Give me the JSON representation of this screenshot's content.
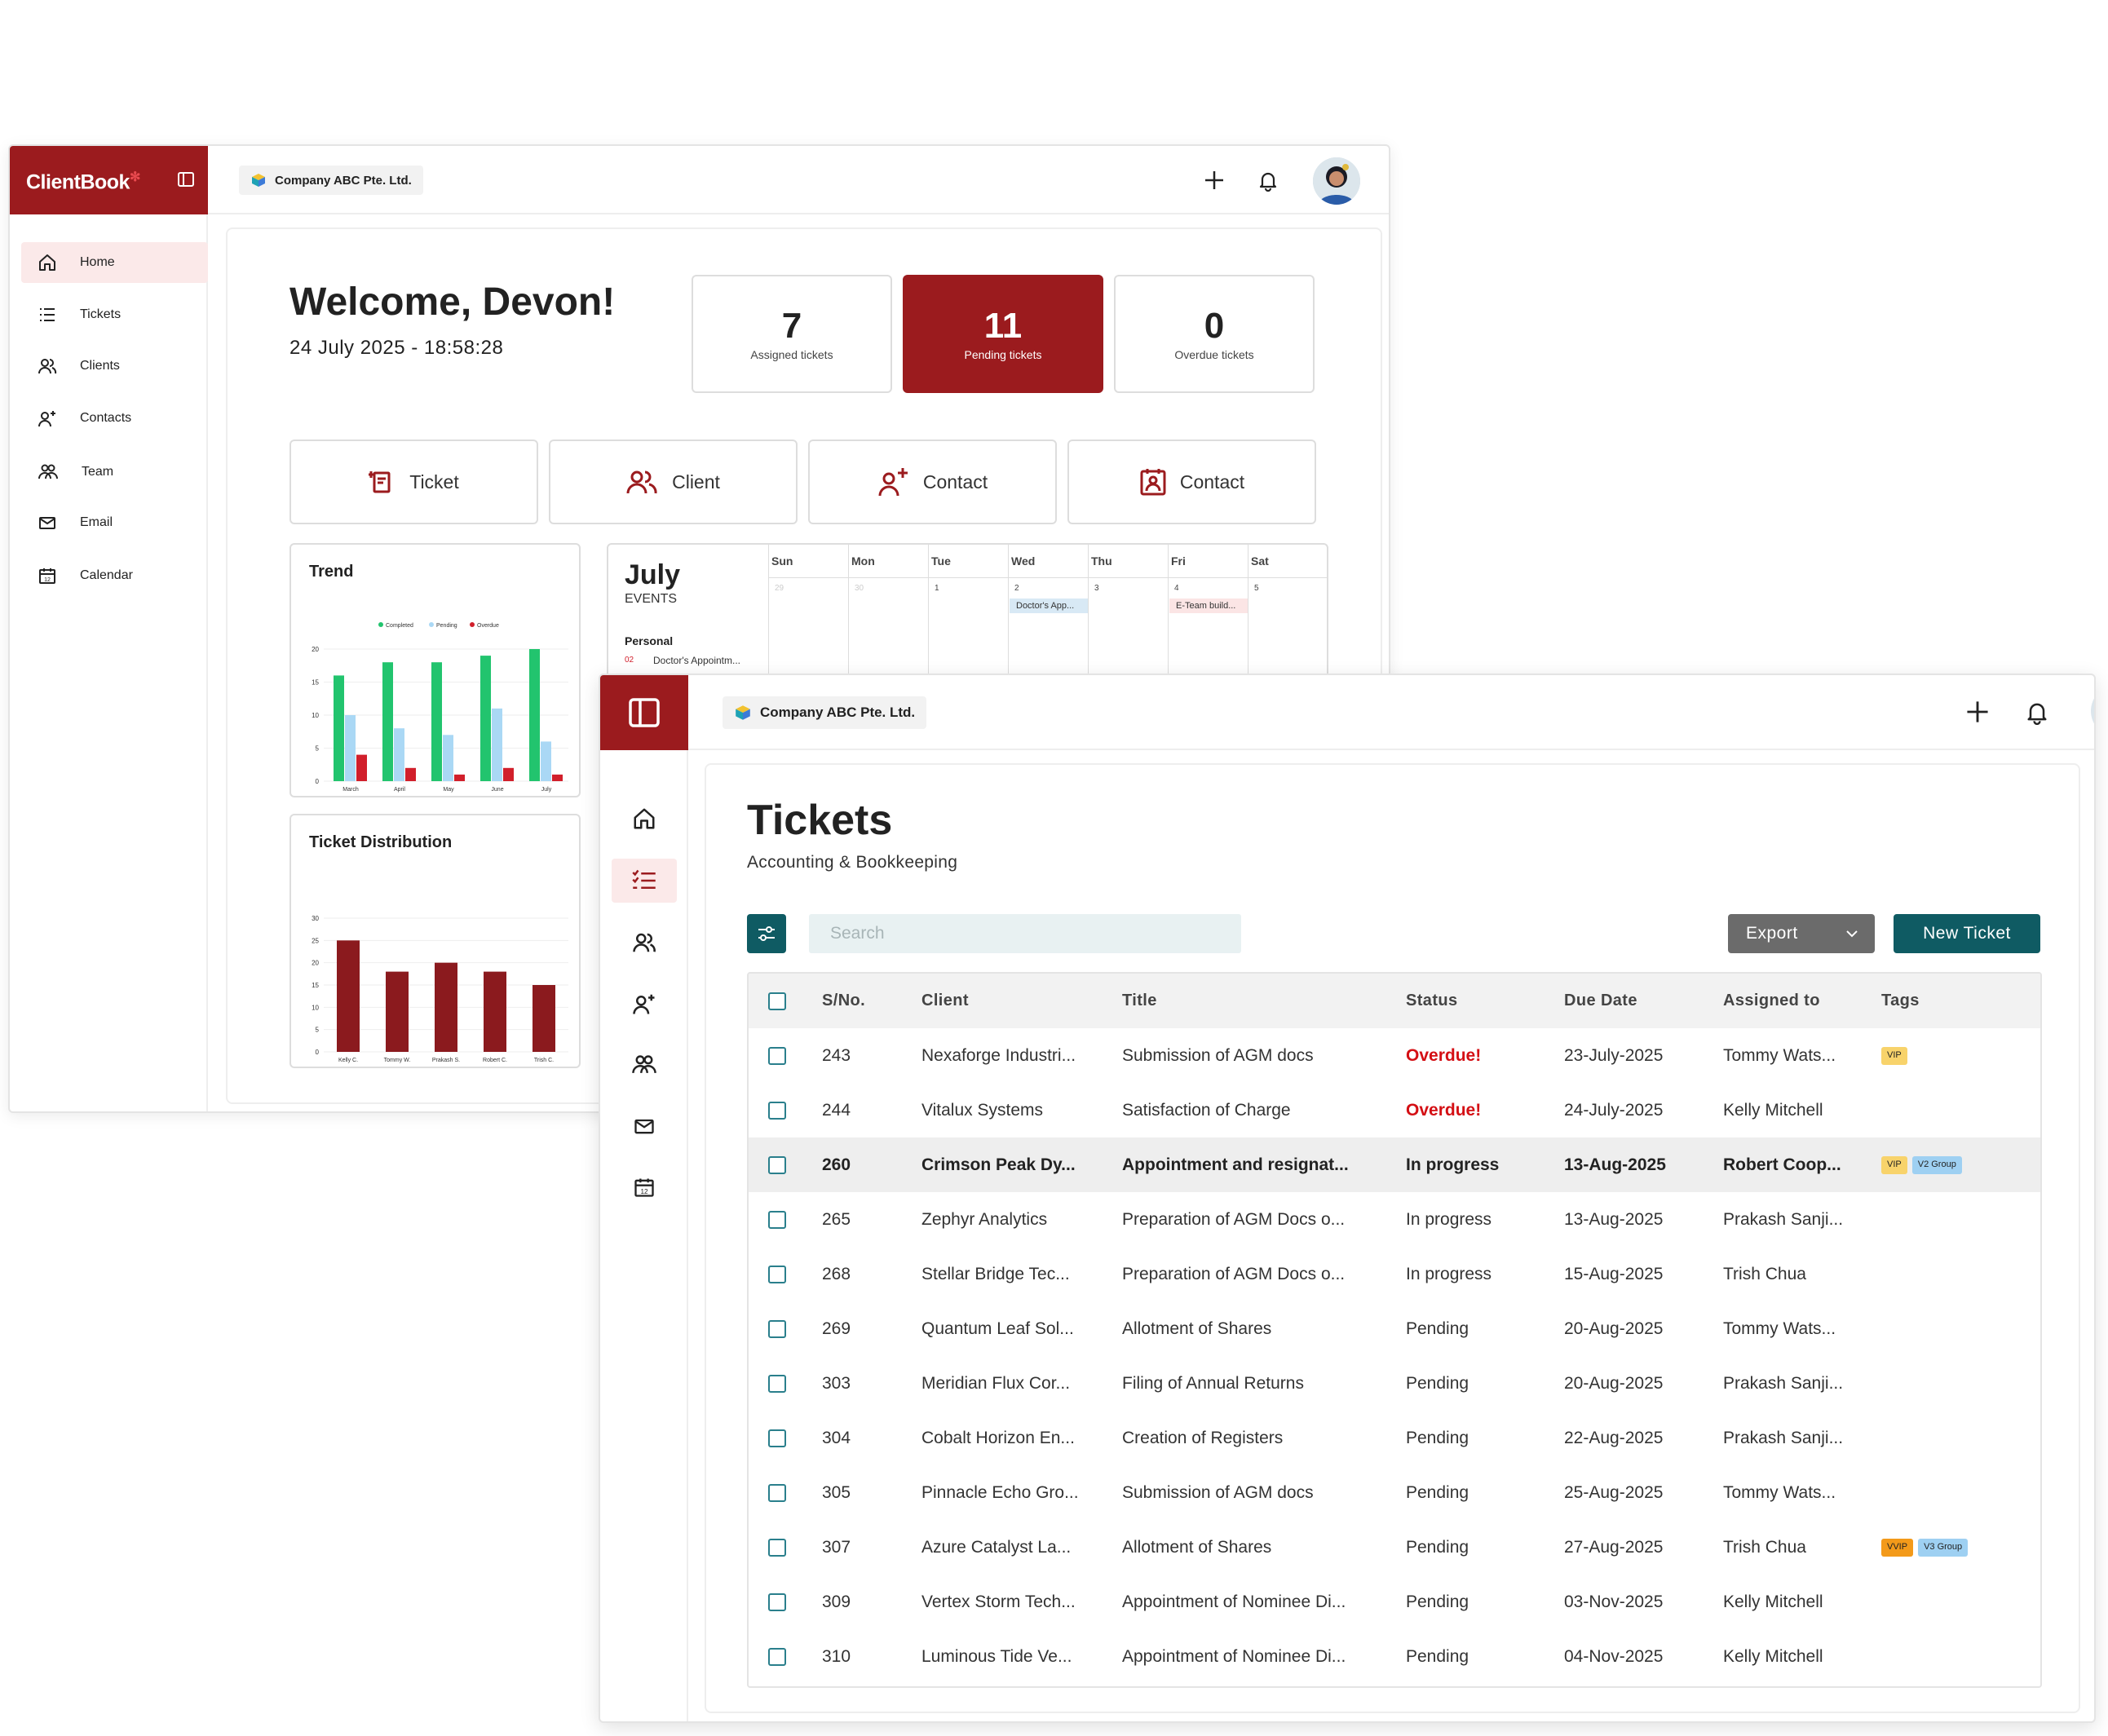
{
  "colors": {
    "brand": "#9b1b1e",
    "teal": "#0f5b63",
    "overdue": "#d40f14",
    "completed": "#22c46e",
    "pending": "#aad8f5",
    "overdue_bar": "#d11f2b",
    "distribution": "#8b1a1e"
  },
  "dashboard": {
    "brand_name": "ClientBook",
    "company": "Company ABC Pte. Ltd.",
    "nav": [
      {
        "label": "Home",
        "icon": "home-icon",
        "active": true
      },
      {
        "label": "Tickets",
        "icon": "list-icon"
      },
      {
        "label": "Clients",
        "icon": "users-icon"
      },
      {
        "label": "Contacts",
        "icon": "user-plus-icon"
      },
      {
        "label": "Team",
        "icon": "team-icon"
      },
      {
        "label": "Email",
        "icon": "mail-icon"
      },
      {
        "label": "Calendar",
        "icon": "calendar-icon"
      }
    ],
    "welcome": "Welcome, Devon!",
    "datetime": "24 July 2025 - 18:58:28",
    "stats": [
      {
        "value": "7",
        "label": "Assigned tickets"
      },
      {
        "value": "11",
        "label": "Pending tickets"
      },
      {
        "value": "0",
        "label": "Overdue tickets"
      }
    ],
    "quick_actions": [
      {
        "label": "Ticket",
        "icon": "ticket-add-icon"
      },
      {
        "label": "Client",
        "icon": "users-icon"
      },
      {
        "label": "Contact",
        "icon": "user-plus-icon"
      },
      {
        "label": "Contact",
        "icon": "contact-card-icon"
      }
    ],
    "calendar": {
      "month": "July",
      "events_label": "EVENTS",
      "personal_label": "Personal",
      "personal_event_day": "02",
      "personal_event": "Doctor's Appointm...",
      "days": [
        "Sun",
        "Mon",
        "Tue",
        "Wed",
        "Thu",
        "Fri",
        "Sat"
      ],
      "dates": [
        "29",
        "30",
        "1",
        "2",
        "3",
        "4",
        "5"
      ],
      "wed_event": "Doctor's App...",
      "fri_event": "E-Team build..."
    }
  },
  "chart_data": [
    {
      "type": "bar",
      "title": "Trend",
      "categories": [
        "March",
        "April",
        "May",
        "June",
        "July"
      ],
      "series": [
        {
          "name": "Completed",
          "values": [
            16,
            18,
            18,
            19,
            20
          ]
        },
        {
          "name": "Pending",
          "values": [
            10,
            8,
            7,
            11,
            6
          ]
        },
        {
          "name": "Overdue",
          "values": [
            4,
            2,
            1,
            2,
            1
          ]
        }
      ],
      "ylim": [
        0,
        20
      ],
      "yticks": [
        "0",
        "5",
        "10",
        "15",
        "20"
      ],
      "legend": "top"
    },
    {
      "type": "bar",
      "title": "Ticket Distribution",
      "categories": [
        "Kelly C.",
        "Tommy W.",
        "Prakash S.",
        "Robert C.",
        "Trish C."
      ],
      "values": [
        25,
        18,
        20,
        18,
        15
      ],
      "ylim": [
        0,
        30
      ],
      "yticks": [
        "0",
        "5",
        "10",
        "15",
        "20",
        "25",
        "30"
      ]
    }
  ],
  "tickets": {
    "company": "Company ABC Pte. Ltd.",
    "title": "Tickets",
    "subtitle": "Accounting & Bookkeeping",
    "search_placeholder": "Search",
    "export_label": "Export",
    "new_ticket_label": "New Ticket",
    "columns": [
      "S/No.",
      "Client",
      "Title",
      "Status",
      "Due Date",
      "Assigned to",
      "Tags"
    ],
    "rows": [
      {
        "sno": "243",
        "client": "Nexaforge Industri...",
        "title": "Submission of  AGM docs",
        "status": "Overdue!",
        "due": "23-July-2025",
        "assigned": "Tommy Wats...",
        "tags": [
          "VIP"
        ]
      },
      {
        "sno": "244",
        "client": "Vitalux Systems",
        "title": "Satisfaction of Charge",
        "status": "Overdue!",
        "due": "24-July-2025",
        "assigned": "Kelly Mitchell",
        "tags": []
      },
      {
        "sno": "260",
        "client": "Crimson Peak Dy...",
        "title": "Appointment and resignat...",
        "status": "In progress",
        "due": "13-Aug-2025",
        "assigned": "Robert Coop...",
        "tags": [
          "VIP",
          "V2 Group"
        ]
      },
      {
        "sno": "265",
        "client": "Zephyr Analytics",
        "title": "Preparation of AGM Docs o...",
        "status": "In progress",
        "due": "13-Aug-2025",
        "assigned": "Prakash Sanji...",
        "tags": []
      },
      {
        "sno": "268",
        "client": "Stellar Bridge Tec...",
        "title": "Preparation of AGM Docs o...",
        "status": "In progress",
        "due": "15-Aug-2025",
        "assigned": "Trish Chua",
        "tags": []
      },
      {
        "sno": "269",
        "client": "Quantum Leaf Sol...",
        "title": "Allotment of Shares",
        "status": "Pending",
        "due": "20-Aug-2025",
        "assigned": "Tommy Wats...",
        "tags": []
      },
      {
        "sno": "303",
        "client": "Meridian Flux Cor...",
        "title": "Filing of Annual Returns",
        "status": "Pending",
        "due": "20-Aug-2025",
        "assigned": "Prakash Sanji...",
        "tags": []
      },
      {
        "sno": "304",
        "client": "Cobalt Horizon En...",
        "title": "Creation of Registers",
        "status": "Pending",
        "due": "22-Aug-2025",
        "assigned": "Prakash Sanji...",
        "tags": []
      },
      {
        "sno": "305",
        "client": "Pinnacle Echo Gro...",
        "title": "Submission of  AGM docs",
        "status": "Pending",
        "due": "25-Aug-2025",
        "assigned": "Tommy Wats...",
        "tags": []
      },
      {
        "sno": "307",
        "client": "Azure Catalyst La...",
        "title": "Allotment of Shares",
        "status": "Pending",
        "due": "27-Aug-2025",
        "assigned": "Trish Chua",
        "tags": [
          "VVIP",
          "V3 Group"
        ]
      },
      {
        "sno": "309",
        "client": "Vertex Storm Tech...",
        "title": "Appointment of Nominee Di...",
        "status": "Pending",
        "due": "03-Nov-2025",
        "assigned": "Kelly Mitchell",
        "tags": []
      },
      {
        "sno": "310",
        "client": "Luminous Tide Ve...",
        "title": "Appointment of Nominee Di...",
        "status": "Pending",
        "due": "04-Nov-2025",
        "assigned": "Kelly Mitchell",
        "tags": []
      }
    ]
  }
}
